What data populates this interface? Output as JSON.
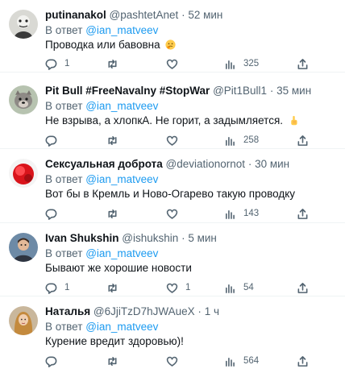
{
  "tweets": [
    {
      "name": "putinanakol",
      "handle": "@pashtetAnet",
      "sep": "·",
      "time": "52 мин",
      "reply_prefix": "В ответ",
      "reply_to": "@ian_matveev",
      "text": "Проводка или бавовна",
      "emoji": "thinking-face",
      "replies": "1",
      "retweets": "",
      "likes": "",
      "views": "325"
    },
    {
      "name": "Pit Bull #FreeNavalny #StopWar",
      "handle": "@Pit1Bull1",
      "sep": "·",
      "time": "35 мин",
      "reply_prefix": "В ответ",
      "reply_to": "@ian_matveev",
      "text": "Не взрыва, а хлопкА. Не горит, а задымляется.",
      "emoji": "pointing-up-hand",
      "replies": "",
      "retweets": "",
      "likes": "",
      "views": "258"
    },
    {
      "name": "Сексуальная доброта",
      "handle": "@deviationornot",
      "sep": "·",
      "time": "30 мин",
      "reply_prefix": "В ответ",
      "reply_to": "@ian_matveev",
      "text": "Вот бы в Кремль и Ново-Огарево такую проводку",
      "emoji": "",
      "replies": "",
      "retweets": "",
      "likes": "",
      "views": "143"
    },
    {
      "name": "Ivan Shukshin",
      "handle": "@ishukshin",
      "sep": "·",
      "time": "5 мин",
      "reply_prefix": "В ответ",
      "reply_to": "@ian_matveev",
      "text": "Бывают же хорошие новости",
      "emoji": "",
      "replies": "1",
      "retweets": "",
      "likes": "1",
      "views": "54"
    },
    {
      "name": "Наталья",
      "handle": "@6JjiTzD7hJWAueX",
      "sep": "·",
      "time": "1 ч",
      "reply_prefix": "В ответ",
      "reply_to": "@ian_matveev",
      "text": "Курение вредит здоровью)!",
      "emoji": "",
      "replies": "",
      "retweets": "",
      "likes": "",
      "views": "564"
    }
  ],
  "colors": {
    "text": "#0f1419",
    "secondary": "#536471",
    "link": "#1d9bf0",
    "divider": "#eff3f4"
  },
  "icons": {
    "reply": "reply-bubble-icon",
    "retweet": "retweet-icon",
    "like": "heart-icon",
    "views": "views-bar-chart-icon",
    "share": "share-icon"
  }
}
